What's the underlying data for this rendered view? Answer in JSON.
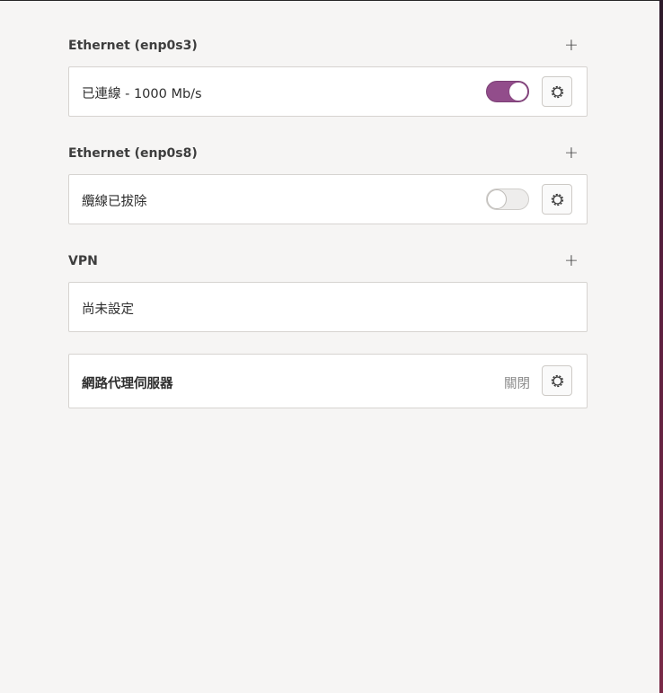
{
  "sections": [
    {
      "title": "Ethernet (enp0s3)",
      "add_label": "+",
      "status": "已連線 - 1000 Mb/s",
      "toggle": "on"
    },
    {
      "title": "Ethernet (enp0s8)",
      "add_label": "+",
      "status": "纜線已拔除",
      "toggle": "off"
    },
    {
      "title": "VPN",
      "add_label": "+",
      "status": "尚未設定"
    }
  ],
  "proxy": {
    "label": "網路代理伺服器",
    "state": "關閉"
  },
  "icons": {
    "add": "plus-icon",
    "settings": "gear-icon"
  },
  "colors": {
    "toggle_on": "#924d8b",
    "background": "#f6f5f4"
  }
}
